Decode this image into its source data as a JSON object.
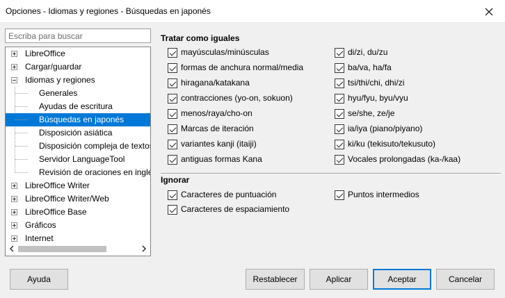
{
  "window": {
    "title": "Opciones - Idiomas y regiones - Búsquedas en japonés"
  },
  "search": {
    "placeholder": "Escriba para buscar"
  },
  "tree": {
    "items": [
      {
        "label": "LibreOffice",
        "level": 0,
        "expander": "plus"
      },
      {
        "label": "Cargar/guardar",
        "level": 0,
        "expander": "plus"
      },
      {
        "label": "Idiomas y regiones",
        "level": 0,
        "expander": "minus"
      },
      {
        "label": "Generales",
        "level": 1
      },
      {
        "label": "Ayudas de escritura",
        "level": 1
      },
      {
        "label": "Búsquedas en japonés",
        "level": 1,
        "selected": true
      },
      {
        "label": "Disposición asiática",
        "level": 1
      },
      {
        "label": "Disposición compleja de textos",
        "level": 1
      },
      {
        "label": "Servidor LanguageTool",
        "level": 1
      },
      {
        "label": "Revisión de oraciones en inglés",
        "level": 1
      },
      {
        "label": "LibreOffice Writer",
        "level": 0,
        "expander": "plus"
      },
      {
        "label": "LibreOffice Writer/Web",
        "level": 0,
        "expander": "plus"
      },
      {
        "label": "LibreOffice Base",
        "level": 0,
        "expander": "plus"
      },
      {
        "label": "Gráficos",
        "level": 0,
        "expander": "plus"
      },
      {
        "label": "Internet",
        "level": 0,
        "expander": "plus"
      }
    ]
  },
  "treat_as_equal": {
    "title": "Tratar como iguales",
    "left": [
      {
        "label": "mayúsculas/minúsculas",
        "checked": true
      },
      {
        "label": "formas de anchura normal/media",
        "checked": true
      },
      {
        "label": "hiragana/katakana",
        "checked": true
      },
      {
        "label": "contracciones (yo-on, sokuon)",
        "checked": true
      },
      {
        "label": "menos/raya/cho-on",
        "checked": true
      },
      {
        "label": "Marcas de iteración",
        "checked": true
      },
      {
        "label": "variantes kanji (itaiji)",
        "checked": true
      },
      {
        "label": "antiguas formas Kana",
        "checked": true
      }
    ],
    "right": [
      {
        "label": "di/zi, du/zu",
        "checked": true
      },
      {
        "label": "ba/va, ha/fa",
        "checked": true
      },
      {
        "label": "tsi/thi/chi, dhi/zi",
        "checked": true
      },
      {
        "label": "hyu/fyu, byu/vyu",
        "checked": true
      },
      {
        "label": "se/she, ze/je",
        "checked": true
      },
      {
        "label": "ia/iya (piano/piyano)",
        "checked": true
      },
      {
        "label": "ki/ku (tekisuto/tekusuto)",
        "checked": true
      },
      {
        "label": "Vocales prolongadas (ka-/kaa)",
        "checked": true
      }
    ]
  },
  "ignore": {
    "title": "Ignorar",
    "left": [
      {
        "label": "Caracteres de puntuación",
        "checked": true
      },
      {
        "label": "Caracteres de espaciamiento",
        "checked": true
      }
    ],
    "right": [
      {
        "label": "Puntos intermedios",
        "checked": true
      }
    ]
  },
  "buttons": {
    "help": "Ayuda",
    "reset": "Restablecer",
    "apply": "Aplicar",
    "ok": "Aceptar",
    "cancel": "Cancelar"
  },
  "colors": {
    "selection": "#0078d7",
    "background": "#f0f0f0"
  }
}
